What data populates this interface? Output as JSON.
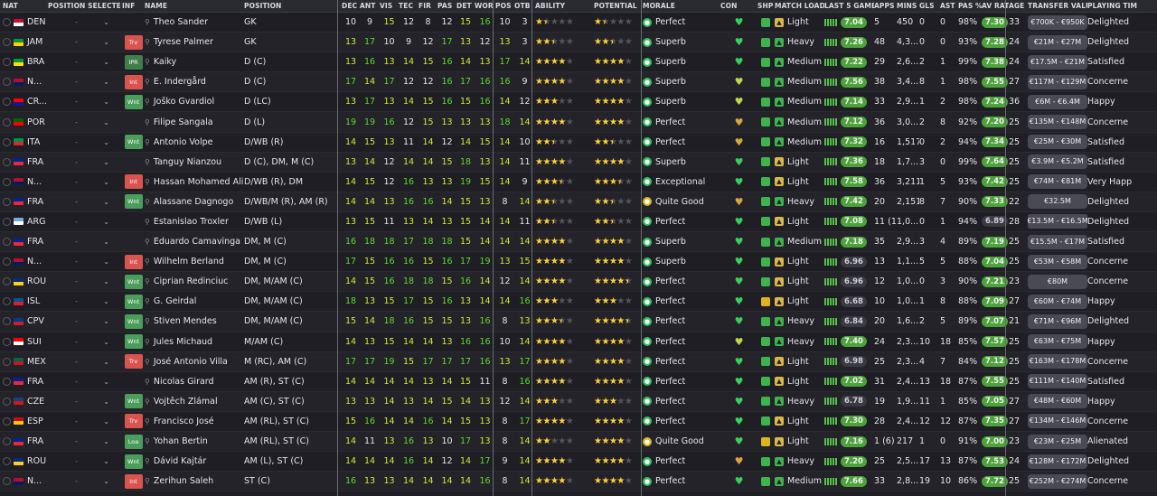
{
  "columns": [
    "NAT",
    "POSITION SELECTED",
    "INF",
    "NAME",
    "POSITION",
    "DEC",
    "ANT",
    "VIS",
    "TEC",
    "FIR",
    "PAS",
    "DET",
    "WOR",
    "POS",
    "OTB",
    "ABILITY",
    "POTENTIAL",
    "MORALE",
    "CON",
    "SHP",
    "MATCH LOAD",
    "LAST 5 GAMES",
    "APPS",
    "MINS",
    "GLS",
    "AST",
    "PAS %",
    "AV RAT",
    "AGE",
    "TRANSFER VALUE",
    "PLAYING TIM"
  ],
  "colors": {
    "accent_green": "#4ca33a",
    "bg": "#1e1e24",
    "inf_red": "#d9534f",
    "inf_green": "#4a9d5a",
    "star": "#ffd23a"
  },
  "rows": [
    {
      "nat": "DEN",
      "flag": [
        "#c8102e",
        "#ffffff"
      ],
      "inf": "",
      "name": "Theo Sander",
      "pos": "GK",
      "attrs": [
        "10",
        "9",
        "15",
        "12",
        "8",
        "12",
        "15",
        "16"
      ],
      "posv": "10",
      "otb": "3",
      "ab": "1.5",
      "pot": "1.5",
      "morale": "Perfect",
      "mood": "g",
      "con": "#37d15a",
      "shp": "#3fb34d",
      "load": "Light",
      "form": "7.04",
      "apps": "5",
      "mins": "450",
      "gls": "0",
      "ast": "0",
      "pas": "98%",
      "avr": "7.30",
      "age": "33",
      "tv": "€700K - €950K",
      "pt": "Delighted"
    },
    {
      "nat": "JAM",
      "flag": [
        "#009b3a",
        "#fed100"
      ],
      "inf": "Trv",
      "name": "Tyrese Palmer",
      "pos": "GK",
      "attrs": [
        "13",
        "17",
        "10",
        "9",
        "12",
        "17",
        "13",
        "12"
      ],
      "posv": "13",
      "otb": "3",
      "ab": "2.5",
      "pot": "2.5",
      "morale": "Superb",
      "mood": "g",
      "con": "#37d15a",
      "shp": "#3fb34d",
      "load": "Heavy",
      "form": "7.26",
      "apps": "48",
      "mins": "4,3...",
      "gls": "0",
      "ast": "0",
      "pas": "93%",
      "avr": "7.28",
      "age": "24",
      "tv": "€21M - €27M",
      "pt": "Delighted"
    },
    {
      "nat": "BRA",
      "flag": [
        "#009c3b",
        "#ffdf00"
      ],
      "inf": "IPR",
      "name": "Kaiky",
      "pos": "D (C)",
      "attrs": [
        "13",
        "16",
        "13",
        "14",
        "15",
        "16",
        "14",
        "13"
      ],
      "posv": "17",
      "otb": "14",
      "ab": "4",
      "pot": "4",
      "morale": "Superb",
      "mood": "g",
      "con": "#37d15a",
      "shp": "#3fb34d",
      "load": "Medium",
      "form": "7.22",
      "apps": "29",
      "mins": "2,6...",
      "gls": "2",
      "ast": "1",
      "pas": "99%",
      "avr": "7.38",
      "age": "24",
      "tv": "€17.5M - €21M",
      "pt": "Satisfied"
    },
    {
      "nat": "N...",
      "flag": [
        "#ba0c2f",
        "#00205b"
      ],
      "inf": "Int",
      "name": "E. Indergård",
      "pos": "D (C)",
      "attrs": [
        "17",
        "14",
        "17",
        "12",
        "12",
        "16",
        "17",
        "16"
      ],
      "posv": "16",
      "otb": "9",
      "ab": "4",
      "pot": "4",
      "morale": "Superb",
      "mood": "g",
      "con": "#b8d94a",
      "shp": "#3fb34d",
      "load": "Medium",
      "form": "7.56",
      "apps": "38",
      "mins": "3,4...",
      "gls": "8",
      "ast": "1",
      "pas": "98%",
      "avr": "7.55",
      "age": "27",
      "tv": "€117M - €129M",
      "pt": "Concerne"
    },
    {
      "nat": "CR...",
      "flag": [
        "#ff0000",
        "#171796"
      ],
      "inf": "Wnt",
      "name": "Joško Gvardiol",
      "pos": "D (LC)",
      "attrs": [
        "13",
        "17",
        "13",
        "14",
        "15",
        "16",
        "15",
        "16"
      ],
      "posv": "14",
      "otb": "12",
      "ab": "3",
      "pot": "4",
      "morale": "Superb",
      "mood": "g",
      "con": "#b8d94a",
      "shp": "#3fb34d",
      "load": "Medium",
      "form": "7.14",
      "apps": "33",
      "mins": "2,9...",
      "gls": "1",
      "ast": "2",
      "pas": "98%",
      "avr": "7.24",
      "age": "36",
      "tv": "€6M - €6.4M",
      "pt": "Happy"
    },
    {
      "nat": "POR",
      "flag": [
        "#006600",
        "#ff0000"
      ],
      "inf": "",
      "name": "Filipe Sangala",
      "pos": "D (L)",
      "attrs": [
        "19",
        "19",
        "16",
        "12",
        "15",
        "13",
        "13",
        "13"
      ],
      "posv": "18",
      "otb": "14",
      "ab": "4",
      "pot": "4",
      "morale": "Perfect",
      "mood": "g",
      "con": "#d9a441",
      "shp": "#3fb34d",
      "load": "Medium",
      "form": "7.12",
      "apps": "36",
      "mins": "3,0...",
      "gls": "2",
      "ast": "8",
      "pas": "92%",
      "avr": "7.20",
      "age": "25",
      "tv": "€135M - €148M",
      "pt": "Concerne"
    },
    {
      "nat": "ITA",
      "flag": [
        "#009246",
        "#ce2b37"
      ],
      "inf": "Wnt",
      "name": "Antonio Volpe",
      "pos": "D/WB (R)",
      "attrs": [
        "14",
        "15",
        "13",
        "11",
        "14",
        "12",
        "14",
        "15"
      ],
      "posv": "14",
      "otb": "10",
      "ab": "2.5",
      "pot": "2.5",
      "morale": "Perfect",
      "mood": "g",
      "con": "#d9a441",
      "shp": "#3fb34d",
      "load": "Medium",
      "form": "7.32",
      "apps": "16",
      "mins": "1,517",
      "gls": "0",
      "ast": "2",
      "pas": "94%",
      "avr": "7.34",
      "age": "25",
      "tv": "€25M - €30M",
      "pt": "Satisfied"
    },
    {
      "nat": "FRA",
      "flag": [
        "#002395",
        "#ed2939"
      ],
      "inf": "",
      "name": "Tanguy Nianzou",
      "pos": "D (C), DM, M (C)",
      "attrs": [
        "13",
        "14",
        "12",
        "14",
        "14",
        "15",
        "18",
        "13"
      ],
      "posv": "14",
      "otb": "11",
      "ab": "4",
      "pot": "4",
      "morale": "Superb",
      "mood": "g",
      "con": "#37d15a",
      "shp": "#3fb34d",
      "load": "Light",
      "form": "7.36",
      "apps": "18",
      "mins": "1,7...",
      "gls": "3",
      "ast": "0",
      "pas": "99%",
      "avr": "7.64",
      "age": "25",
      "tv": "€3.9M - €5.2M",
      "pt": "Satisfied"
    },
    {
      "nat": "N...",
      "flag": [
        "#ba0c2f",
        "#00205b"
      ],
      "inf": "Int",
      "name": "Hassan Mohamed Ali",
      "pos": "D/WB (R), DM",
      "attrs": [
        "14",
        "15",
        "12",
        "16",
        "13",
        "13",
        "19",
        "15"
      ],
      "posv": "14",
      "otb": "9",
      "ab": "3.5",
      "pot": "3.5",
      "morale": "Exceptional",
      "mood": "g",
      "con": "#37d15a",
      "shp": "#3fb34d",
      "load": "Light",
      "form": "7.58",
      "apps": "36",
      "mins": "3,211",
      "gls": "1",
      "ast": "5",
      "pas": "93%",
      "avr": "7.42",
      "age": "25",
      "tv": "€74M - €81M",
      "pt": "Very Happ"
    },
    {
      "nat": "FRA",
      "flag": [
        "#002395",
        "#ed2939"
      ],
      "inf": "Wnt",
      "name": "Alassane Dagnogo",
      "pos": "D/WB/M (R), AM (R)",
      "attrs": [
        "14",
        "14",
        "13",
        "16",
        "16",
        "14",
        "15",
        "13"
      ],
      "posv": "8",
      "otb": "14",
      "ab": "2.5",
      "pot": "2.5",
      "morale": "Quite Good",
      "mood": "y",
      "con": "#d9a441",
      "shp": "#3fb34d",
      "load": "Heavy",
      "form": "7.42",
      "apps": "20",
      "mins": "2,151",
      "gls": "8",
      "ast": "7",
      "pas": "90%",
      "avr": "7.33",
      "age": "22",
      "tv": "€32.5M",
      "pt": "Delighted"
    },
    {
      "nat": "ARG",
      "flag": [
        "#74acdf",
        "#ffffff"
      ],
      "inf": "",
      "name": "Estanislao Troxler",
      "pos": "D/WB (L)",
      "attrs": [
        "13",
        "15",
        "11",
        "13",
        "14",
        "13",
        "15",
        "14"
      ],
      "posv": "14",
      "otb": "11",
      "ab": "2.5",
      "pot": "2.5",
      "morale": "Perfect",
      "mood": "g",
      "con": "#37d15a",
      "shp": "#3fb34d",
      "load": "Light",
      "form": "7.08",
      "apps": "11 (1)",
      "mins": "1,0...",
      "gls": "0",
      "ast": "1",
      "pas": "94%",
      "avr": "6.89",
      "age": "28",
      "tv": "€13.5M - €16.5M",
      "pt": "Delighted"
    },
    {
      "nat": "FRA",
      "flag": [
        "#002395",
        "#ed2939"
      ],
      "inf": "",
      "name": "Eduardo Camavinga",
      "pos": "DM, M (C)",
      "attrs": [
        "16",
        "18",
        "18",
        "17",
        "18",
        "18",
        "15",
        "14"
      ],
      "posv": "14",
      "otb": "14",
      "ab": "4",
      "pot": "4",
      "morale": "Superb",
      "mood": "g",
      "con": "#37d15a",
      "shp": "#3fb34d",
      "load": "Medium",
      "form": "7.18",
      "apps": "35",
      "mins": "2,9...",
      "gls": "3",
      "ast": "4",
      "pas": "89%",
      "avr": "7.19",
      "age": "25",
      "tv": "€15.5M - €17M",
      "pt": "Satisfied"
    },
    {
      "nat": "N...",
      "flag": [
        "#ba0c2f",
        "#00205b"
      ],
      "inf": "Int",
      "name": "Wilhelm Berland",
      "pos": "DM, M (C)",
      "attrs": [
        "17",
        "15",
        "16",
        "16",
        "15",
        "16",
        "17",
        "19"
      ],
      "posv": "13",
      "otb": "15",
      "ab": "4",
      "pot": "4",
      "morale": "Superb",
      "mood": "g",
      "con": "#37d15a",
      "shp": "#3fb34d",
      "load": "Light",
      "form": "6.96",
      "apps": "13",
      "mins": "1,1...",
      "gls": "5",
      "ast": "5",
      "pas": "88%",
      "avr": "7.04",
      "age": "25",
      "tv": "€53M - €58M",
      "pt": "Concerne"
    },
    {
      "nat": "ROU",
      "flag": [
        "#002b7f",
        "#fcd116"
      ],
      "inf": "Wnt",
      "name": "Ciprian Redinciuc",
      "pos": "DM, M/AM (C)",
      "attrs": [
        "14",
        "15",
        "16",
        "18",
        "18",
        "15",
        "16",
        "14"
      ],
      "posv": "12",
      "otb": "14",
      "ab": "4",
      "pot": "4.5",
      "morale": "Perfect",
      "mood": "g",
      "con": "#37d15a",
      "shp": "#3fb34d",
      "load": "Light",
      "form": "6.96",
      "apps": "12",
      "mins": "1,0...",
      "gls": "0",
      "ast": "3",
      "pas": "90%",
      "avr": "7.21",
      "age": "23",
      "tv": "€80M",
      "pt": "Concerne"
    },
    {
      "nat": "ISL",
      "flag": [
        "#02529c",
        "#dc1e35"
      ],
      "inf": "Wnt",
      "name": "G. Geirdal",
      "pos": "DM, M/AM (C)",
      "attrs": [
        "18",
        "13",
        "15",
        "17",
        "15",
        "16",
        "13",
        "14"
      ],
      "posv": "14",
      "otb": "16",
      "ab": "3",
      "pot": "3",
      "morale": "Perfect",
      "mood": "g",
      "con": "#37d15a",
      "shp": "#e0b320",
      "load": "Light",
      "form": "6.68",
      "apps": "10",
      "mins": "1,0...",
      "gls": "1",
      "ast": "8",
      "pas": "88%",
      "avr": "7.09",
      "age": "27",
      "tv": "€60M - €74M",
      "pt": "Happy"
    },
    {
      "nat": "CPV",
      "flag": [
        "#003893",
        "#cf2027"
      ],
      "inf": "Wnt",
      "name": "Stiven Mendes",
      "pos": "DM, M/AM (C)",
      "attrs": [
        "15",
        "14",
        "18",
        "16",
        "15",
        "15",
        "13",
        "16"
      ],
      "posv": "8",
      "otb": "13",
      "ab": "3.5",
      "pot": "4.5",
      "morale": "Perfect",
      "mood": "g",
      "con": "#37d15a",
      "shp": "#3fb34d",
      "load": "Heavy",
      "form": "6.84",
      "apps": "20",
      "mins": "1,6...",
      "gls": "2",
      "ast": "5",
      "pas": "89%",
      "avr": "7.07",
      "age": "21",
      "tv": "€71M - €96M",
      "pt": "Delighted"
    },
    {
      "nat": "SUI",
      "flag": [
        "#ff0000",
        "#ffffff"
      ],
      "inf": "Wnt",
      "name": "Jules Michaud",
      "pos": "M/AM (C)",
      "attrs": [
        "14",
        "13",
        "15",
        "14",
        "14",
        "13",
        "16",
        "16"
      ],
      "posv": "10",
      "otb": "14",
      "ab": "4",
      "pot": "4",
      "morale": "Perfect",
      "mood": "g",
      "con": "#b8d94a",
      "shp": "#3fb34d",
      "load": "Heavy",
      "form": "7.40",
      "apps": "24",
      "mins": "2,3...",
      "gls": "10",
      "ast": "18",
      "pas": "85%",
      "avr": "7.57",
      "age": "25",
      "tv": "€63M - €75M",
      "pt": "Happy"
    },
    {
      "nat": "MEX",
      "flag": [
        "#006847",
        "#ce1126"
      ],
      "inf": "Trv",
      "name": "José Antonio Villa",
      "pos": "M (RC), AM (C)",
      "attrs": [
        "17",
        "17",
        "19",
        "15",
        "17",
        "17",
        "17",
        "16"
      ],
      "posv": "13",
      "otb": "17",
      "ab": "4",
      "pot": "4",
      "morale": "Perfect",
      "mood": "g",
      "con": "#37d15a",
      "shp": "#3fb34d",
      "load": "Light",
      "form": "6.98",
      "apps": "25",
      "mins": "2,3...",
      "gls": "4",
      "ast": "7",
      "pas": "84%",
      "avr": "7.12",
      "age": "25",
      "tv": "€163M - €178M",
      "pt": "Concerne"
    },
    {
      "nat": "FRA",
      "flag": [
        "#002395",
        "#ed2939"
      ],
      "inf": "",
      "name": "Nicolas Girard",
      "pos": "AM (R), ST (C)",
      "attrs": [
        "14",
        "14",
        "14",
        "14",
        "13",
        "14",
        "15",
        "11"
      ],
      "posv": "8",
      "otb": "16",
      "ab": "4",
      "pot": "4",
      "morale": "Perfect",
      "mood": "g",
      "con": "#37d15a",
      "shp": "#3fb34d",
      "load": "Light",
      "form": "7.02",
      "apps": "31",
      "mins": "2,4...",
      "gls": "13",
      "ast": "18",
      "pas": "87%",
      "avr": "7.55",
      "age": "25",
      "tv": "€111M - €140M",
      "pt": "Satisfied"
    },
    {
      "nat": "CZE",
      "flag": [
        "#11457e",
        "#d7141a"
      ],
      "inf": "Wnt",
      "name": "Vojtěch Zlámal",
      "pos": "AM (C), ST (C)",
      "attrs": [
        "13",
        "13",
        "14",
        "13",
        "14",
        "15",
        "14",
        "13"
      ],
      "posv": "12",
      "otb": "14",
      "ab": "3",
      "pot": "3",
      "morale": "Perfect",
      "mood": "g",
      "con": "#37d15a",
      "shp": "#3fb34d",
      "load": "Heavy",
      "form": "6.78",
      "apps": "19",
      "mins": "1,9...",
      "gls": "11",
      "ast": "1",
      "pas": "85%",
      "avr": "7.05",
      "age": "27",
      "tv": "€48M - €60M",
      "pt": "Happy"
    },
    {
      "nat": "ESP",
      "flag": [
        "#c60b1e",
        "#ffc400"
      ],
      "inf": "Trv",
      "name": "Francisco José",
      "pos": "AM (RL), ST (C)",
      "attrs": [
        "15",
        "16",
        "14",
        "14",
        "16",
        "14",
        "15",
        "13"
      ],
      "posv": "8",
      "otb": "17",
      "ab": "4",
      "pot": "4",
      "morale": "Perfect",
      "mood": "g",
      "con": "#37d15a",
      "shp": "#3fb34d",
      "load": "Light",
      "form": "7.30",
      "apps": "28",
      "mins": "2,4...",
      "gls": "12",
      "ast": "12",
      "pas": "87%",
      "avr": "7.35",
      "age": "27",
      "tv": "€134M - €146M",
      "pt": "Concerne"
    },
    {
      "nat": "FRA",
      "flag": [
        "#002395",
        "#ed2939"
      ],
      "inf": "Loa",
      "name": "Yohan Bertin",
      "pos": "AM (RL), ST (C)",
      "attrs": [
        "14",
        "11",
        "13",
        "16",
        "13",
        "10",
        "17",
        "13"
      ],
      "posv": "8",
      "otb": "14",
      "ab": "2",
      "pot": "4",
      "morale": "Quite Good",
      "mood": "y",
      "con": "#37d15a",
      "shp": "#e0b320",
      "load": "Light",
      "form": "7.16",
      "apps": "1 (6)",
      "mins": "217",
      "gls": "1",
      "ast": "0",
      "pas": "91%",
      "avr": "7.00",
      "age": "23",
      "tv": "€23M - €25M",
      "pt": "Alienated"
    },
    {
      "nat": "ROU",
      "flag": [
        "#002b7f",
        "#fcd116"
      ],
      "inf": "Wnt",
      "name": "Dávid Kajtár",
      "pos": "AM (L), ST (C)",
      "attrs": [
        "14",
        "14",
        "14",
        "16",
        "14",
        "12",
        "14",
        "17"
      ],
      "posv": "9",
      "otb": "14",
      "ab": "4",
      "pot": "4",
      "morale": "Perfect",
      "mood": "g",
      "con": "#d9a441",
      "shp": "#3fb34d",
      "load": "Heavy",
      "form": "7.20",
      "apps": "25",
      "mins": "2,5...",
      "gls": "17",
      "ast": "13",
      "pas": "87%",
      "avr": "7.53",
      "age": "24",
      "tv": "€128M - €172M",
      "pt": "Delighted"
    },
    {
      "nat": "N...",
      "flag": [
        "#ba0c2f",
        "#00205b"
      ],
      "inf": "Int",
      "name": "Zerihun Saleh",
      "pos": "ST (C)",
      "attrs": [
        "16",
        "13",
        "13",
        "14",
        "14",
        "14",
        "14",
        "16"
      ],
      "posv": "8",
      "otb": "14",
      "ab": "4",
      "pot": "4",
      "morale": "Perfect",
      "mood": "g",
      "con": "#37d15a",
      "shp": "#3fb34d",
      "load": "Medium",
      "form": "7.66",
      "apps": "33",
      "mins": "2,8...",
      "gls": "19",
      "ast": "10",
      "pas": "86%",
      "avr": "7.72",
      "age": "25",
      "tv": "€252M - €274M",
      "pt": "Concerne"
    }
  ]
}
